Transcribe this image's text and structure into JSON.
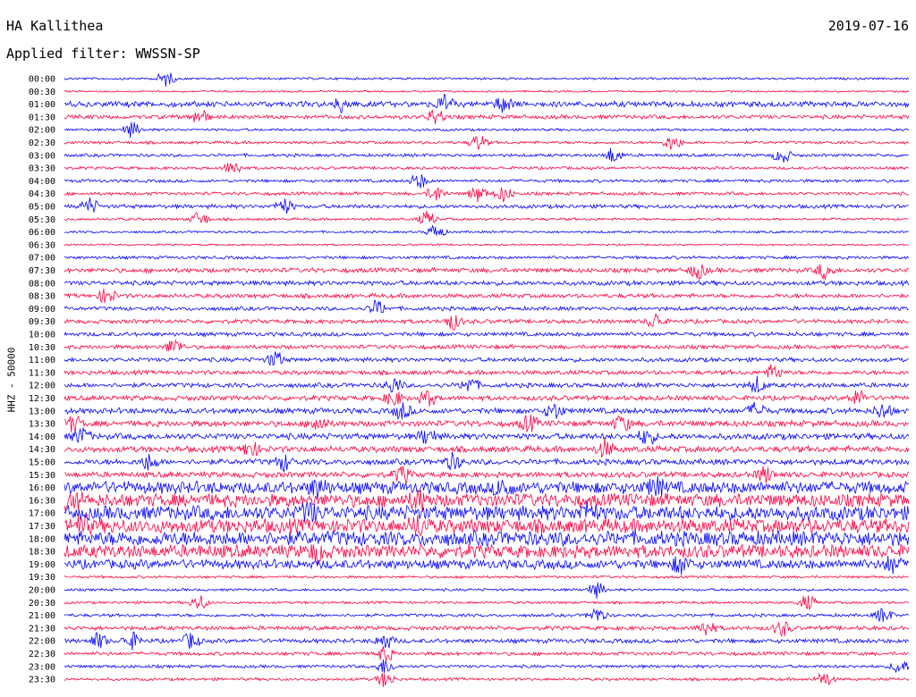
{
  "header": {
    "station": "HA Kallithea",
    "date": "2019-07-16",
    "filter": "Applied filter: WWSSN-SP"
  },
  "chart_data": {
    "type": "line",
    "title": "HA Kallithea",
    "subtitle": "Applied filter: WWSSN-SP",
    "ylabel": "HHZ - 50000",
    "xlabel": "",
    "x": {
      "unit": "minutes past line start",
      "range": [
        0,
        30
      ]
    },
    "colors": {
      "odd": "#0000ff",
      "even": "#ff0040"
    },
    "rows": [
      {
        "time": "00:00",
        "amplitude": 0.22,
        "color": "#0000ff",
        "events": [
          0.12
        ]
      },
      {
        "time": "00:30",
        "amplitude": 0.18,
        "color": "#ff0040",
        "events": []
      },
      {
        "time": "01:00",
        "amplitude": 0.55,
        "color": "#0000ff",
        "events": [
          0.33,
          0.45,
          0.52
        ]
      },
      {
        "time": "01:30",
        "amplitude": 0.4,
        "color": "#ff0040",
        "events": [
          0.16,
          0.44
        ]
      },
      {
        "time": "02:00",
        "amplitude": 0.25,
        "color": "#0000ff",
        "events": [
          0.08
        ]
      },
      {
        "time": "02:30",
        "amplitude": 0.28,
        "color": "#ff0040",
        "events": [
          0.49,
          0.72
        ]
      },
      {
        "time": "03:00",
        "amplitude": 0.3,
        "color": "#0000ff",
        "events": [
          0.65,
          0.85
        ]
      },
      {
        "time": "03:30",
        "amplitude": 0.28,
        "color": "#ff0040",
        "events": [
          0.2
        ]
      },
      {
        "time": "04:00",
        "amplitude": 0.3,
        "color": "#0000ff",
        "events": [
          0.42
        ]
      },
      {
        "time": "04:30",
        "amplitude": 0.32,
        "color": "#ff0040",
        "events": [
          0.44,
          0.49,
          0.52
        ]
      },
      {
        "time": "05:00",
        "amplitude": 0.38,
        "color": "#0000ff",
        "events": [
          0.03,
          0.26
        ]
      },
      {
        "time": "05:30",
        "amplitude": 0.25,
        "color": "#ff0040",
        "events": [
          0.16,
          0.43
        ]
      },
      {
        "time": "06:00",
        "amplitude": 0.22,
        "color": "#0000ff",
        "events": [
          0.44
        ]
      },
      {
        "time": "06:30",
        "amplitude": 0.18,
        "color": "#ff0040",
        "events": []
      },
      {
        "time": "07:00",
        "amplitude": 0.3,
        "color": "#0000ff",
        "events": []
      },
      {
        "time": "07:30",
        "amplitude": 0.45,
        "color": "#ff0040",
        "events": [
          0.75,
          0.9
        ]
      },
      {
        "time": "08:00",
        "amplitude": 0.45,
        "color": "#0000ff",
        "events": []
      },
      {
        "time": "08:30",
        "amplitude": 0.42,
        "color": "#ff0040",
        "events": [
          0.05
        ]
      },
      {
        "time": "09:00",
        "amplitude": 0.38,
        "color": "#0000ff",
        "events": [
          0.37
        ]
      },
      {
        "time": "09:30",
        "amplitude": 0.4,
        "color": "#ff0040",
        "events": [
          0.46,
          0.7
        ]
      },
      {
        "time": "10:00",
        "amplitude": 0.4,
        "color": "#0000ff",
        "events": []
      },
      {
        "time": "10:30",
        "amplitude": 0.4,
        "color": "#ff0040",
        "events": [
          0.13
        ]
      },
      {
        "time": "11:00",
        "amplitude": 0.42,
        "color": "#0000ff",
        "events": [
          0.25
        ]
      },
      {
        "time": "11:30",
        "amplitude": 0.42,
        "color": "#ff0040",
        "events": [
          0.84
        ]
      },
      {
        "time": "12:00",
        "amplitude": 0.45,
        "color": "#0000ff",
        "events": [
          0.39,
          0.48,
          0.82
        ]
      },
      {
        "time": "12:30",
        "amplitude": 0.48,
        "color": "#ff0040",
        "events": [
          0.39,
          0.43,
          0.94
        ]
      },
      {
        "time": "13:00",
        "amplitude": 0.55,
        "color": "#0000ff",
        "events": [
          0.4,
          0.58,
          0.82,
          0.97
        ]
      },
      {
        "time": "13:30",
        "amplitude": 0.58,
        "color": "#ff0040",
        "events": [
          0.01,
          0.3,
          0.55,
          0.66
        ]
      },
      {
        "time": "14:00",
        "amplitude": 0.6,
        "color": "#0000ff",
        "events": [
          0.02,
          0.43,
          0.69
        ]
      },
      {
        "time": "14:30",
        "amplitude": 0.6,
        "color": "#ff0040",
        "events": [
          0.22,
          0.64
        ]
      },
      {
        "time": "15:00",
        "amplitude": 0.55,
        "color": "#0000ff",
        "events": [
          0.1,
          0.26,
          0.46
        ]
      },
      {
        "time": "15:30",
        "amplitude": 0.55,
        "color": "#ff0040",
        "events": [
          0.4,
          0.83
        ]
      },
      {
        "time": "16:00",
        "amplitude": 1.2,
        "color": "#0000ff",
        "events": [
          0.3,
          0.52,
          0.7
        ]
      },
      {
        "time": "16:30",
        "amplitude": 1.3,
        "color": "#ff0040",
        "events": [
          0.01,
          0.42
        ]
      },
      {
        "time": "17:00",
        "amplitude": 1.4,
        "color": "#0000ff",
        "events": [
          0.29,
          0.62
        ]
      },
      {
        "time": "17:30",
        "amplitude": 1.4,
        "color": "#ff0040",
        "events": [
          0.02,
          0.42
        ]
      },
      {
        "time": "18:00",
        "amplitude": 1.45,
        "color": "#0000ff",
        "events": []
      },
      {
        "time": "18:30",
        "amplitude": 1.3,
        "color": "#ff0040",
        "events": [
          0.3
        ]
      },
      {
        "time": "19:00",
        "amplitude": 0.9,
        "color": "#0000ff",
        "events": [
          0.73,
          0.98
        ]
      },
      {
        "time": "19:30",
        "amplitude": 0.25,
        "color": "#ff0040",
        "events": []
      },
      {
        "time": "20:00",
        "amplitude": 0.25,
        "color": "#0000ff",
        "events": [
          0.63
        ]
      },
      {
        "time": "20:30",
        "amplitude": 0.25,
        "color": "#ff0040",
        "events": [
          0.16,
          0.88
        ]
      },
      {
        "time": "21:00",
        "amplitude": 0.3,
        "color": "#0000ff",
        "events": [
          0.63,
          0.97
        ]
      },
      {
        "time": "21:30",
        "amplitude": 0.4,
        "color": "#ff0040",
        "events": [
          0.76,
          0.85
        ]
      },
      {
        "time": "22:00",
        "amplitude": 0.42,
        "color": "#0000ff",
        "events": [
          0.04,
          0.08,
          0.15,
          0.38
        ]
      },
      {
        "time": "22:30",
        "amplitude": 0.35,
        "color": "#ff0040",
        "events": [
          0.38
        ]
      },
      {
        "time": "23:00",
        "amplitude": 0.3,
        "color": "#0000ff",
        "events": [
          0.38,
          0.99
        ]
      },
      {
        "time": "23:30",
        "amplitude": 0.28,
        "color": "#ff0040",
        "events": [
          0.38,
          0.9
        ]
      }
    ]
  }
}
